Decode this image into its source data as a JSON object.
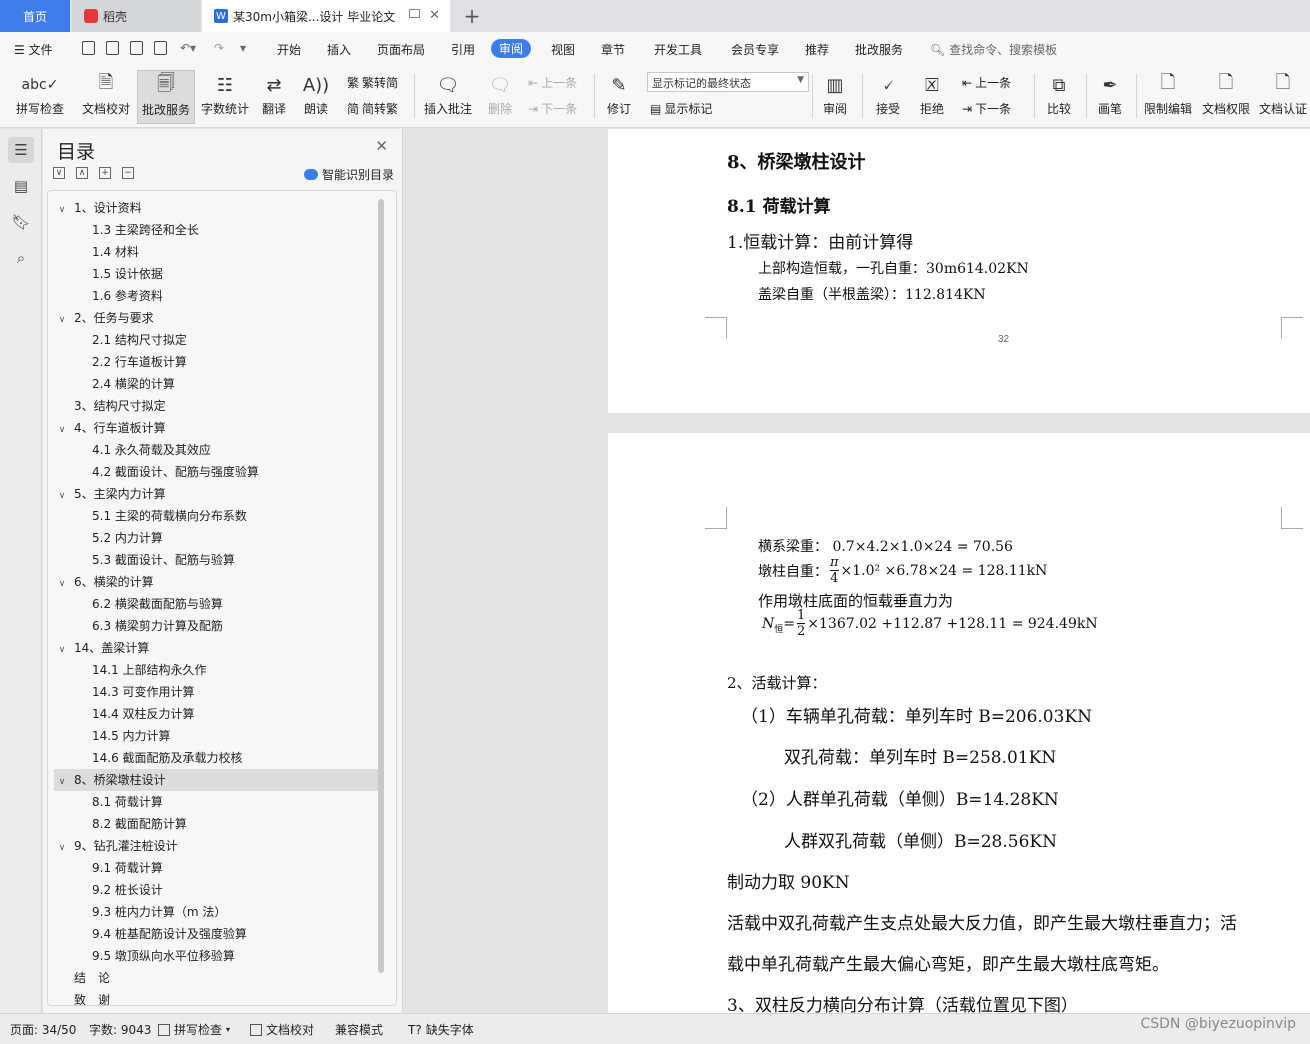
{
  "tabs": {
    "home": "首页",
    "daoke": "稻壳",
    "doc": "某30m小箱梁...设计 毕业论文",
    "add": "+"
  },
  "menu": {
    "file": "文件",
    "items": [
      "开始",
      "插入",
      "页面布局",
      "引用",
      "审阅",
      "视图",
      "章节",
      "开发工具",
      "会员专享",
      "推荐",
      "批改服务"
    ],
    "active": "审阅",
    "search": "查找命令、搜索模板"
  },
  "ribbon": {
    "spell": "拼写检查",
    "proof": "文档校对",
    "correct": "批改服务",
    "wordcount": "字数统计",
    "translate": "翻译",
    "read": "朗读",
    "trad": "繁转简",
    "simp": "简转繁",
    "insert_comment": "插入批注",
    "delete": "删除",
    "prev1": "上一条",
    "next1": "下一条",
    "revise": "修订",
    "dropdown": "显示标记的最终状态",
    "show_marks": "显示标记",
    "review": "审阅",
    "accept": "接受",
    "reject": "拒绝",
    "prev2": "上一条",
    "next2": "下一条",
    "compare": "比较",
    "pen": "画笔",
    "restrict": "限制编辑",
    "perm": "文档权限",
    "cert": "文档认证"
  },
  "nav": {
    "title": "目录",
    "smart": "智能识别目录",
    "items": [
      {
        "label": "1、设计资料",
        "level": 1,
        "chev": "∨"
      },
      {
        "label": "1.3 主梁跨径和全长",
        "level": 2
      },
      {
        "label": "1.4 材料",
        "level": 2
      },
      {
        "label": "1.5 设计依据",
        "level": 2
      },
      {
        "label": "1.6 参考资料",
        "level": 2
      },
      {
        "label": "2、任务与要求",
        "level": 1,
        "chev": "∨"
      },
      {
        "label": "2.1 结构尺寸拟定",
        "level": 2
      },
      {
        "label": "2.2 行车道板计算",
        "level": 2
      },
      {
        "label": "2.4 横梁的计算",
        "level": 2
      },
      {
        "label": "3、结构尺寸拟定",
        "level": 1,
        "chev": ""
      },
      {
        "label": "4、行车道板计算",
        "level": 1,
        "chev": "∨"
      },
      {
        "label": "4.1 永久荷载及其效应",
        "level": 2
      },
      {
        "label": "4.2 截面设计、配筋与强度验算",
        "level": 2
      },
      {
        "label": "5、主梁内力计算",
        "level": 1,
        "chev": "∨"
      },
      {
        "label": "5.1 主梁的荷载横向分布系数",
        "level": 2
      },
      {
        "label": "5.2 内力计算",
        "level": 2
      },
      {
        "label": "5.3 截面设计、配筋与验算",
        "level": 2
      },
      {
        "label": "6、横梁的计算",
        "level": 1,
        "chev": "∨"
      },
      {
        "label": "6.2 横梁截面配筋与验算",
        "level": 2
      },
      {
        "label": "6.3 横梁剪力计算及配筋",
        "level": 2
      },
      {
        "label": "14、盖梁计算",
        "level": 1,
        "chev": "∨"
      },
      {
        "label": "14.1 上部结构永久作",
        "level": 2
      },
      {
        "label": "14.3 可变作用计算",
        "level": 2
      },
      {
        "label": "14.4 双柱反力计算",
        "level": 2
      },
      {
        "label": "14.5 内力计算",
        "level": 2
      },
      {
        "label": "14.6 截面配筋及承载力校核",
        "level": 2
      },
      {
        "label": "8、桥梁墩柱设计",
        "level": 1,
        "chev": "∨",
        "selected": true
      },
      {
        "label": "8.1 荷载计算",
        "level": 2
      },
      {
        "label": "8.2 截面配筋计算",
        "level": 2
      },
      {
        "label": "9、钻孔灌注桩设计",
        "level": 1,
        "chev": "∨"
      },
      {
        "label": "9.1 荷载计算",
        "level": 2
      },
      {
        "label": "9.2 桩长设计",
        "level": 2
      },
      {
        "label": "9.3 桩内力计算（m 法）",
        "level": 2
      },
      {
        "label": "9.4 桩基配筋设计及强度验算",
        "level": 2
      },
      {
        "label": "9.5 墩顶纵向水平位移验算",
        "level": 2
      },
      {
        "label": "结　论",
        "level": 1,
        "chev": ""
      },
      {
        "label": "致　谢",
        "level": 1,
        "chev": ""
      }
    ]
  },
  "doc": {
    "h1": "8、桥梁墩柱设计",
    "h2": "8.1 荷载计算",
    "p1": "1.恒载计算：由前计算得",
    "p2": "上部构造恒载，一孔自重：30m614.02KN",
    "p3": "盖梁自重（半根盖梁）：112.814KN",
    "page_num": "32",
    "l1": "横系梁重：  0.7×4.2×1.0×24 = 70.56",
    "l2a": "墩柱自重：",
    "l2_num": "π",
    "l2_den": "4",
    "l2b": "×1.0² ×6.78×24 = 128.11kN",
    "l3": "作用墩柱底面的恒载垂直力为",
    "l4a": "N",
    "l4sub": "恒",
    "l4eq": " = ",
    "l4_num": "1",
    "l4_den": "2",
    "l4b": "×1367.02 +112.87 +128.11 = 924.49kN",
    "l5": "2、活载计算：",
    "l6": "（1）车辆单孔荷载：单列车时   B=206.03KN",
    "l7": "双孔荷载：单列车时   B=258.01KN",
    "l8": "（2）人群单孔荷载（单侧）B=14.28KN",
    "l9": "人群双孔荷载（单侧）B=28.56KN",
    "l10": "制动力取 90KN",
    "l11": "活载中双孔荷载产生支点处最大反力值，即产生最大墩柱垂直力；活",
    "l12": "载中单孔荷载产生最大偏心弯矩，即产生最大墩柱底弯矩。",
    "l13": "3、双柱反力横向分布计算（活载位置见下图）"
  },
  "status": {
    "page": "页面: 34/50",
    "words": "字数: 9043",
    "spell": "拼写检查",
    "proof": "文档校对",
    "compat": "兼容模式",
    "missing_font": "缺失字体"
  },
  "watermark": "CSDN @biyezuopinvip",
  "colors": {
    "accent": "#3f7ee8"
  }
}
